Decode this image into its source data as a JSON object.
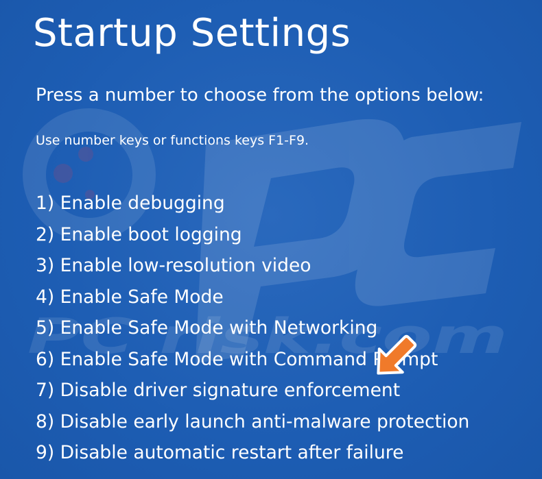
{
  "screen": {
    "title": "Startup Settings",
    "subtitle": "Press a number to choose from the options below:",
    "hint": "Use number keys or functions keys F1-F9.",
    "options": [
      {
        "label": "1) Enable debugging"
      },
      {
        "label": "2) Enable boot logging"
      },
      {
        "label": "3) Enable low-resolution video"
      },
      {
        "label": "4) Enable Safe Mode"
      },
      {
        "label": "5) Enable Safe Mode with Networking"
      },
      {
        "label": "6) Enable Safe Mode with Command Prompt"
      },
      {
        "label": "7) Disable driver signature enforcement"
      },
      {
        "label": "8) Disable early launch anti-malware protection"
      },
      {
        "label": "9) Disable automatic restart after failure"
      }
    ]
  },
  "colors": {
    "background": "#1f5fb5",
    "text": "#ffffff",
    "arrow": "#f07a2a"
  },
  "watermark": {
    "text": "PC risk.com"
  }
}
